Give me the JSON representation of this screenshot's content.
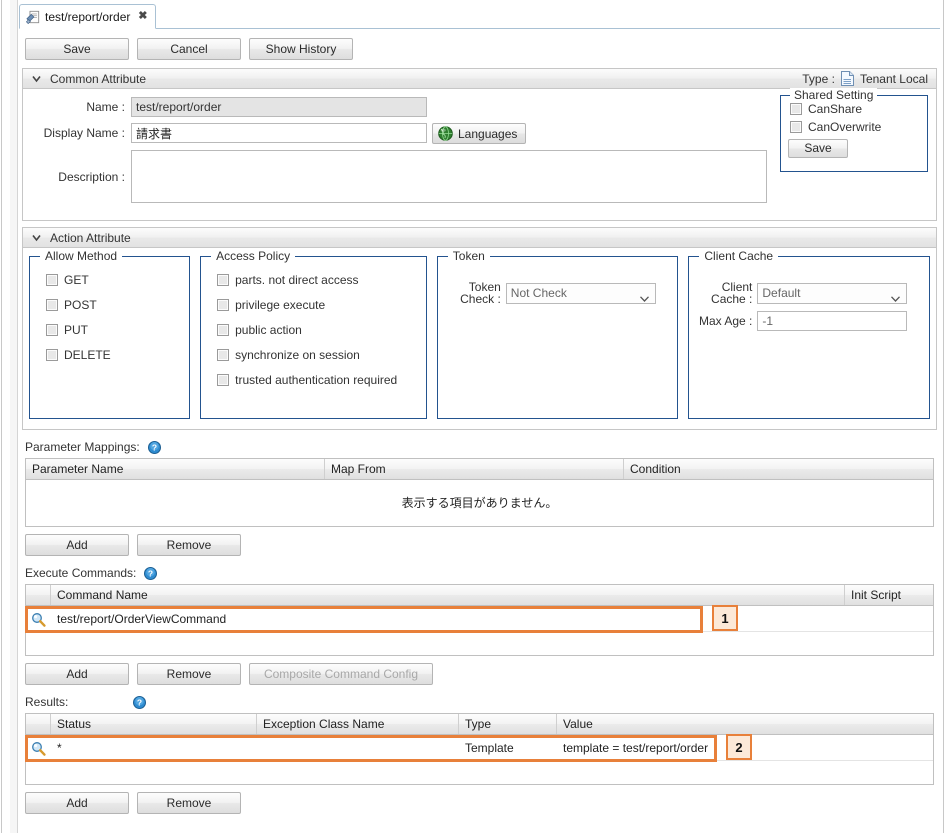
{
  "tab": {
    "label": "test/report/order",
    "icon": "action-file-icon",
    "close": "✖"
  },
  "toolbar": {
    "save": "Save",
    "cancel": "Cancel",
    "show_history": "Show History"
  },
  "common_attribute": {
    "title": "Common Attribute",
    "type_label": "Type :",
    "type_value": "Tenant Local",
    "name_label": "Name :",
    "name_value": "test/report/order",
    "display_name_label": "Display Name :",
    "display_name_value": "請求書",
    "languages_button": "Languages",
    "description_label": "Description :",
    "description_value": "",
    "shared_setting": {
      "legend": "Shared Setting",
      "can_share": "CanShare",
      "can_overwrite": "CanOverwrite",
      "save": "Save"
    }
  },
  "action_attribute": {
    "title": "Action Attribute",
    "allow_method": {
      "legend": "Allow Method",
      "items": [
        "GET",
        "POST",
        "PUT",
        "DELETE"
      ]
    },
    "access_policy": {
      "legend": "Access Policy",
      "items": [
        "parts. not direct access",
        "privilege execute",
        "public action",
        "synchronize on session",
        "trusted authentication required"
      ]
    },
    "token": {
      "legend": "Token",
      "check_label": "Token Check :",
      "check_value": "Not Check"
    },
    "client_cache": {
      "legend": "Client Cache",
      "cache_label": "Client Cache :",
      "cache_value": "Default",
      "max_age_label": "Max Age :",
      "max_age_value": "-1"
    }
  },
  "parameter_mappings": {
    "label": "Parameter Mappings:",
    "columns": [
      "Parameter Name",
      "Map From",
      "Condition"
    ],
    "empty_message": "表示する項目がありません。",
    "add": "Add",
    "remove": "Remove"
  },
  "execute_commands": {
    "label": "Execute Commands:",
    "columns": [
      "",
      "Command Name",
      "Init Script"
    ],
    "rows": [
      {
        "icon": "search-icon",
        "command_name": "test/report/OrderViewCommand",
        "init_script": ""
      }
    ],
    "add": "Add",
    "remove": "Remove",
    "composite": "Composite Command Config"
  },
  "results": {
    "label": "Results:",
    "columns": [
      "",
      "Status",
      "Exception Class Name",
      "Type",
      "Value"
    ],
    "rows": [
      {
        "icon": "search-icon",
        "status": "*",
        "exception_class_name": "",
        "type": "Template",
        "value": "template = test/report/order"
      }
    ],
    "add": "Add",
    "remove": "Remove"
  },
  "annotations": [
    {
      "number": "1"
    },
    {
      "number": "2"
    }
  ],
  "colors": {
    "highlight": "#e8803a",
    "marker_fill": "#fce9d8",
    "fieldset_border": "#23538f"
  }
}
